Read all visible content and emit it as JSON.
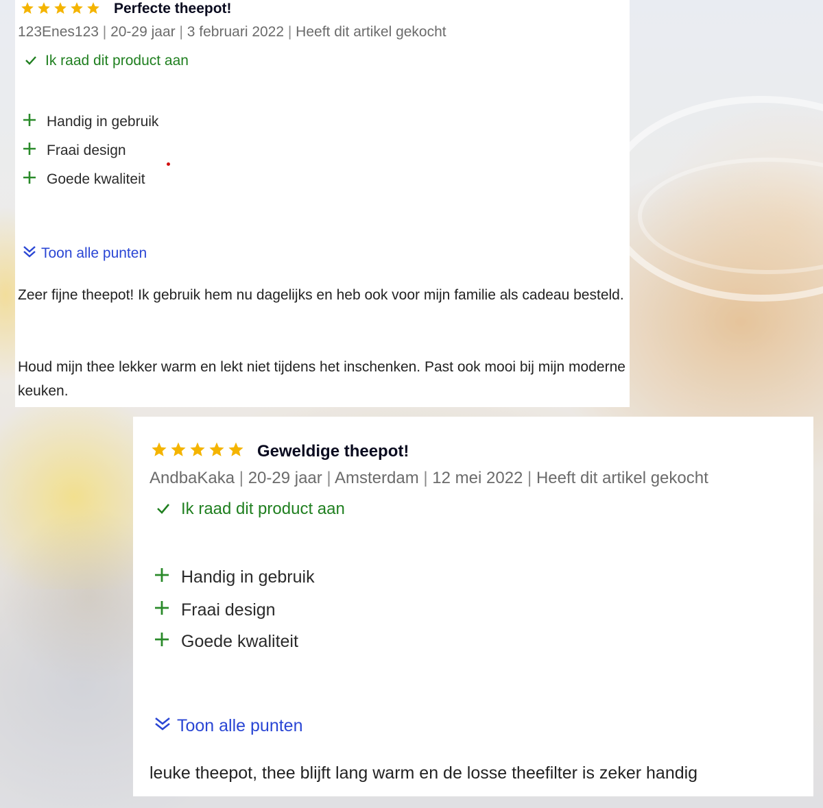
{
  "colors": {
    "star": "#f4b400",
    "title": "#0a0b1f",
    "meta": "#6b6b6b",
    "recommend": "#1f7f1f",
    "pro_icon": "#2a8a2a",
    "link": "#2a46d4"
  },
  "reviews": [
    {
      "rating": 5,
      "title": "Perfecte theepot!",
      "meta": [
        "123Enes123",
        "20-29 jaar",
        "3 februari 2022",
        "Heeft dit artikel gekocht"
      ],
      "separator": "|",
      "recommend": "Ik raad dit product aan",
      "pros": [
        "Handig in gebruik",
        "Fraai design",
        "Goede kwaliteit"
      ],
      "show_all": "Toon alle punten",
      "paragraphs": [
        "Zeer fijne theepot! Ik gebruik hem nu dagelijks en heb ook voor mijn familie als cadeau besteld.",
        "Houd mijn thee lekker warm en lekt niet tijdens het inschenken. Past ook mooi bij mijn moderne keuken."
      ]
    },
    {
      "rating": 5,
      "title": "Geweldige theepot!",
      "meta": [
        "AndbaKaka",
        "20-29 jaar",
        "Amsterdam",
        "12 mei 2022",
        "Heeft dit artikel gekocht"
      ],
      "separator": "|",
      "recommend": "Ik raad dit product aan",
      "pros": [
        "Handig in gebruik",
        "Fraai design",
        "Goede kwaliteit"
      ],
      "show_all": "Toon alle punten",
      "paragraphs": [
        "leuke theepot, thee blijft lang warm en de losse theefilter is zeker handig"
      ]
    }
  ]
}
